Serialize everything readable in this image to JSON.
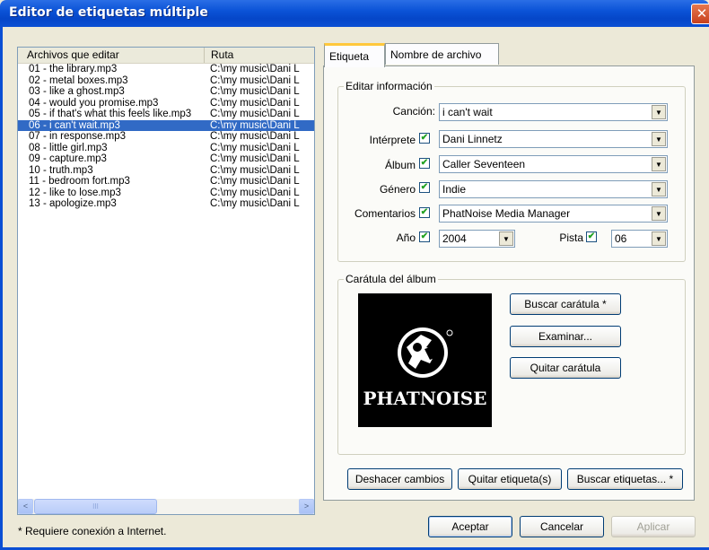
{
  "window": {
    "title": "Editor de etiquetas múltiple",
    "close": "✕"
  },
  "file_list": {
    "columns": [
      "Archivos que editar",
      "Ruta"
    ],
    "rows": [
      {
        "name": "01 - the library.mp3",
        "path": "C:\\my music\\Dani L"
      },
      {
        "name": "02 - metal boxes.mp3",
        "path": "C:\\my music\\Dani L"
      },
      {
        "name": "03 - like a ghost.mp3",
        "path": "C:\\my music\\Dani L"
      },
      {
        "name": "04 - would you promise.mp3",
        "path": "C:\\my music\\Dani L"
      },
      {
        "name": "05 - if that's what this feels like.mp3",
        "path": "C:\\my music\\Dani L"
      },
      {
        "name": "06 - i can't wait.mp3",
        "path": "C:\\my music\\Dani L",
        "selected": true
      },
      {
        "name": "07 - in response.mp3",
        "path": "C:\\my music\\Dani L"
      },
      {
        "name": "08 - little girl.mp3",
        "path": "C:\\my music\\Dani L"
      },
      {
        "name": "09 - capture.mp3",
        "path": "C:\\my music\\Dani L"
      },
      {
        "name": "10 - truth.mp3",
        "path": "C:\\my music\\Dani L"
      },
      {
        "name": "11 - bedroom fort.mp3",
        "path": "C:\\my music\\Dani L"
      },
      {
        "name": "12 - like to lose.mp3",
        "path": "C:\\my music\\Dani L"
      },
      {
        "name": "13 - apologize.mp3",
        "path": "C:\\my music\\Dani L"
      }
    ],
    "scroll_left": "<",
    "scroll_right": ">",
    "scroll_thumb": "III"
  },
  "note": "* Requiere conexión a Internet.",
  "tabs": [
    "Etiqueta",
    "Nombre de archivo"
  ],
  "edit_info": {
    "group_label": "Editar información",
    "song": {
      "label": "Canción:",
      "value": "i can't wait"
    },
    "artist": {
      "label": "Intérprete",
      "value": "Dani Linnetz",
      "checked": true
    },
    "album": {
      "label": "Álbum",
      "value": "Caller Seventeen",
      "checked": true
    },
    "genre": {
      "label": "Género",
      "value": "Indie",
      "checked": true
    },
    "comments": {
      "label": "Comentarios",
      "value": "PhatNoise Media Manager",
      "checked": true
    },
    "year": {
      "label": "Año",
      "value": "2004",
      "checked": true
    },
    "track": {
      "label": "Pista",
      "value": "06",
      "checked": true
    }
  },
  "cover": {
    "group_label": "Carátula del álbum",
    "logo_text": "PHATNOISE",
    "search_button": "Buscar carátula *",
    "browse_button": "Examinar...",
    "remove_button": "Quitar carátula"
  },
  "tag_buttons": {
    "undo": "Deshacer cambios",
    "remove_tags": "Quitar etiqueta(s)",
    "search_tags": "Buscar etiquetas... *"
  },
  "dialog_buttons": {
    "ok": "Aceptar",
    "cancel": "Cancelar",
    "apply": "Aplicar"
  },
  "colors": {
    "title_bar": "#0b53d7",
    "selection": "#316ac5",
    "tab_highlight": "#ffc83c"
  }
}
